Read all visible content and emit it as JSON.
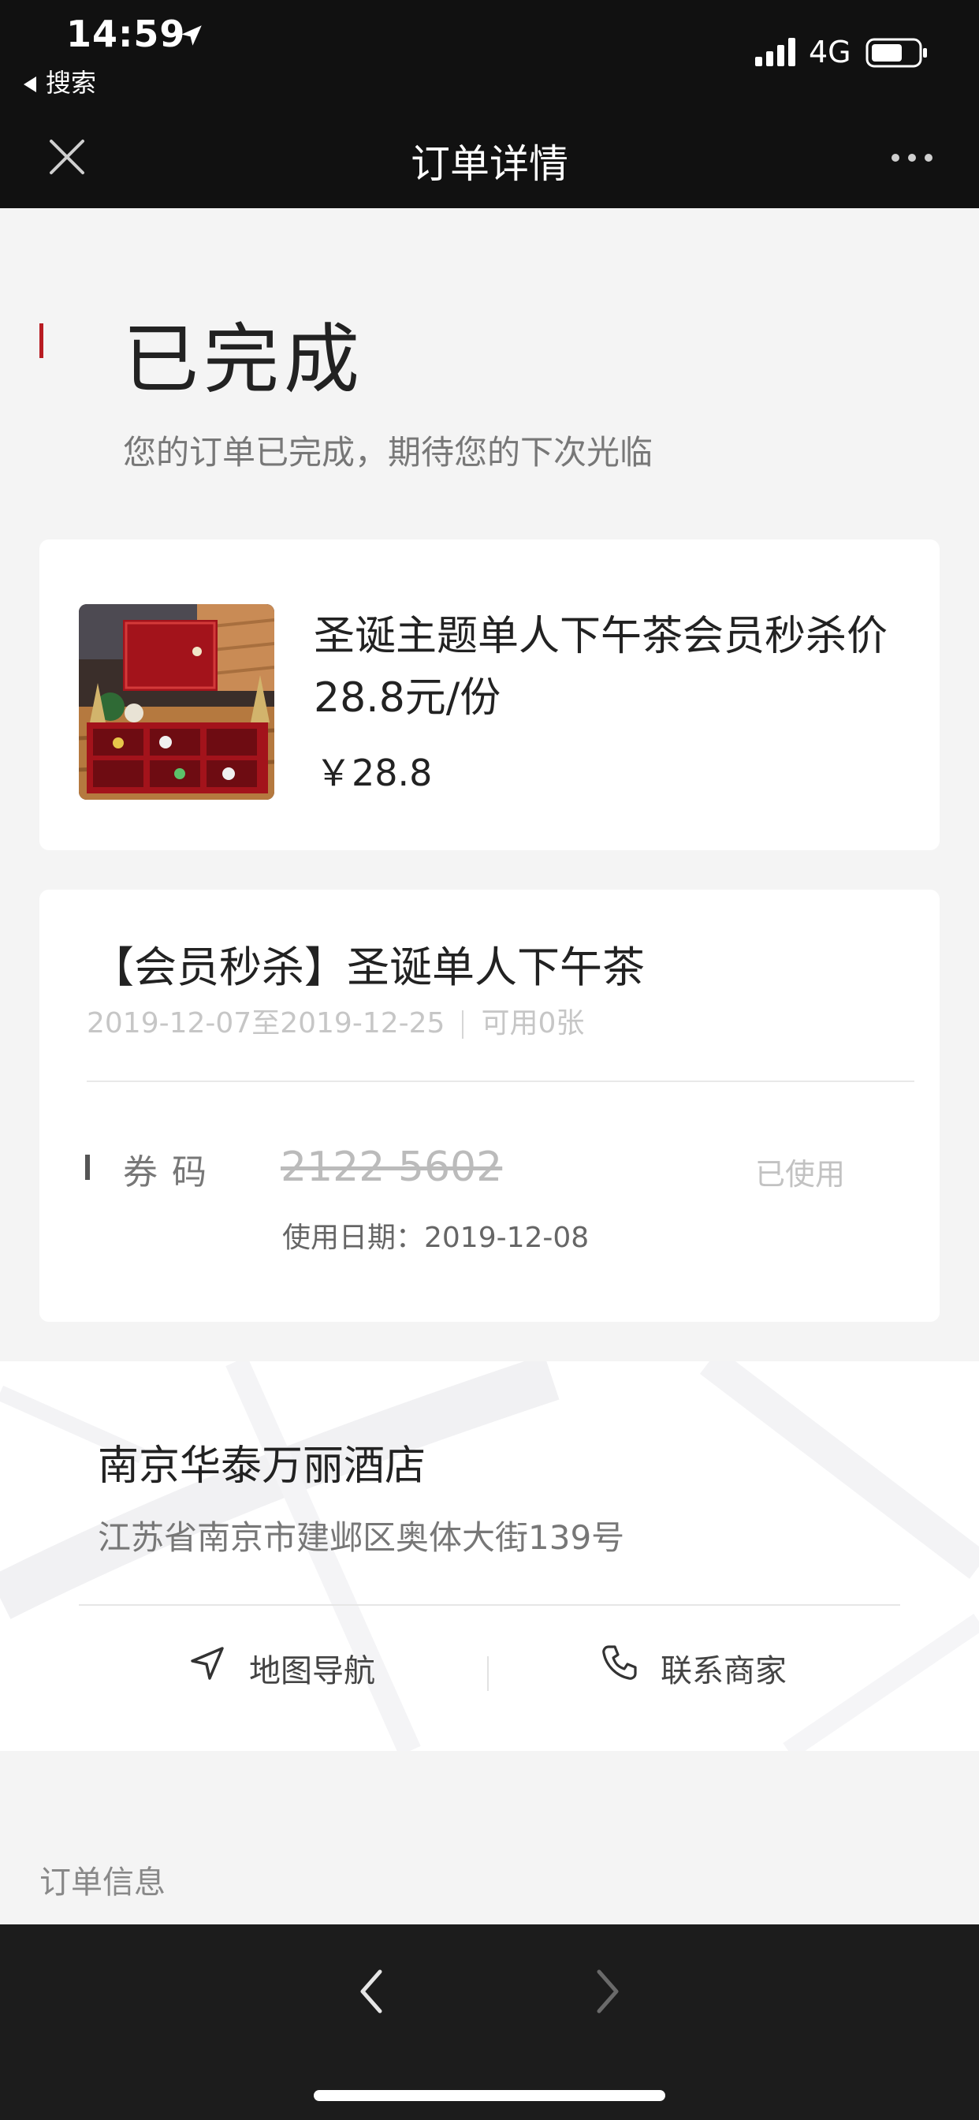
{
  "status_bar": {
    "time": "14:59",
    "back_app": "搜索",
    "network": "4G"
  },
  "nav": {
    "title": "订单详情"
  },
  "order_status": {
    "title": "已完成",
    "description": "您的订单已完成，期待您的下次光临"
  },
  "product": {
    "name": "圣诞主题单人下午茶会员秒杀价28.8元/份",
    "price": "￥28.8"
  },
  "coupon": {
    "title": "【会员秒杀】圣诞单人下午茶",
    "validity": "2019-12-07至2019-12-25",
    "available": "可用0张",
    "code_label": "券码",
    "code": "2122 5602",
    "code_status": "已使用",
    "use_date": "使用日期：2019-12-08"
  },
  "hotel": {
    "name": "南京华泰万丽酒店",
    "address": "江苏省南京市建邺区奥体大街139号",
    "navigate_label": "地图导航",
    "contact_label": "联系商家"
  },
  "order_info": {
    "label": "订单信息"
  },
  "colors": {
    "accent": "#b81c22",
    "header_bg": "#111111",
    "page_bg": "#f4f4f4"
  }
}
